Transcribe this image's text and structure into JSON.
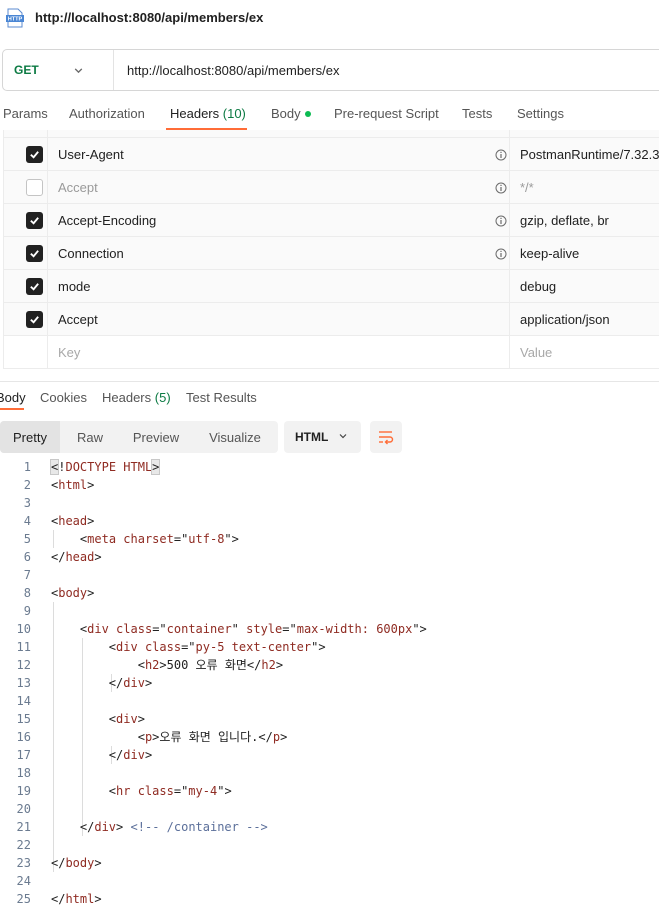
{
  "window": {
    "title": "http://localhost:8080/api/members/ex",
    "icon": "http-file-icon"
  },
  "request": {
    "method": "GET",
    "url": "http://localhost:8080/api/members/ex"
  },
  "request_tabs": [
    {
      "label": "Params"
    },
    {
      "label": "Authorization"
    },
    {
      "label": "Headers",
      "count": "(10)",
      "active": true
    },
    {
      "label": "Body",
      "dot": true
    },
    {
      "label": "Pre-request Script"
    },
    {
      "label": "Tests"
    },
    {
      "label": "Settings"
    }
  ],
  "headers": [
    {
      "key": "User-Agent",
      "value": "PostmanRuntime/7.32.3",
      "checked": true,
      "info": true
    },
    {
      "key": "Accept",
      "value": "*/*",
      "checked": false,
      "info": true
    },
    {
      "key": "Accept-Encoding",
      "value": "gzip, deflate, br",
      "checked": true,
      "info": true
    },
    {
      "key": "Connection",
      "value": "keep-alive",
      "checked": true,
      "info": true
    },
    {
      "key": "mode",
      "value": "debug",
      "checked": true,
      "info": false
    },
    {
      "key": "Accept",
      "value": "application/json",
      "checked": true,
      "info": false
    }
  ],
  "new_header": {
    "key_placeholder": "Key",
    "value_placeholder": "Value"
  },
  "response_tabs": [
    {
      "label": "Body",
      "active": true
    },
    {
      "label": "Cookies"
    },
    {
      "label": "Headers",
      "count": "(5)"
    },
    {
      "label": "Test Results"
    }
  ],
  "format": {
    "modes": [
      "Pretty",
      "Raw",
      "Preview",
      "Visualize"
    ],
    "active_mode": "Pretty",
    "language": "HTML",
    "wrap_icon": "wrap-lines-icon"
  },
  "code_lines": [
    "<!DOCTYPE HTML>",
    "<html>",
    "",
    "<head>",
    "    <meta charset=\"utf-8\">",
    "</head>",
    "",
    "<body>",
    "",
    "    <div class=\"container\" style=\"max-width: 600px\">",
    "        <div class=\"py-5 text-center\">",
    "            <h2>500 오류 화면</h2>",
    "        </div>",
    "",
    "        <div>",
    "            <p>오류 화면 입니다.</p>",
    "        </div>",
    "",
    "        <hr class=\"my-4\">",
    "",
    "    </div> <!-- /container -->",
    "",
    "</body>",
    "",
    "</html>"
  ],
  "colors": {
    "accent": "#ff6c37",
    "method_get": "#0c7a43",
    "tag": "#8f2b22",
    "attr": "#b51a1a",
    "string": "#1a41b5",
    "comment": "#5b6f9a"
  }
}
